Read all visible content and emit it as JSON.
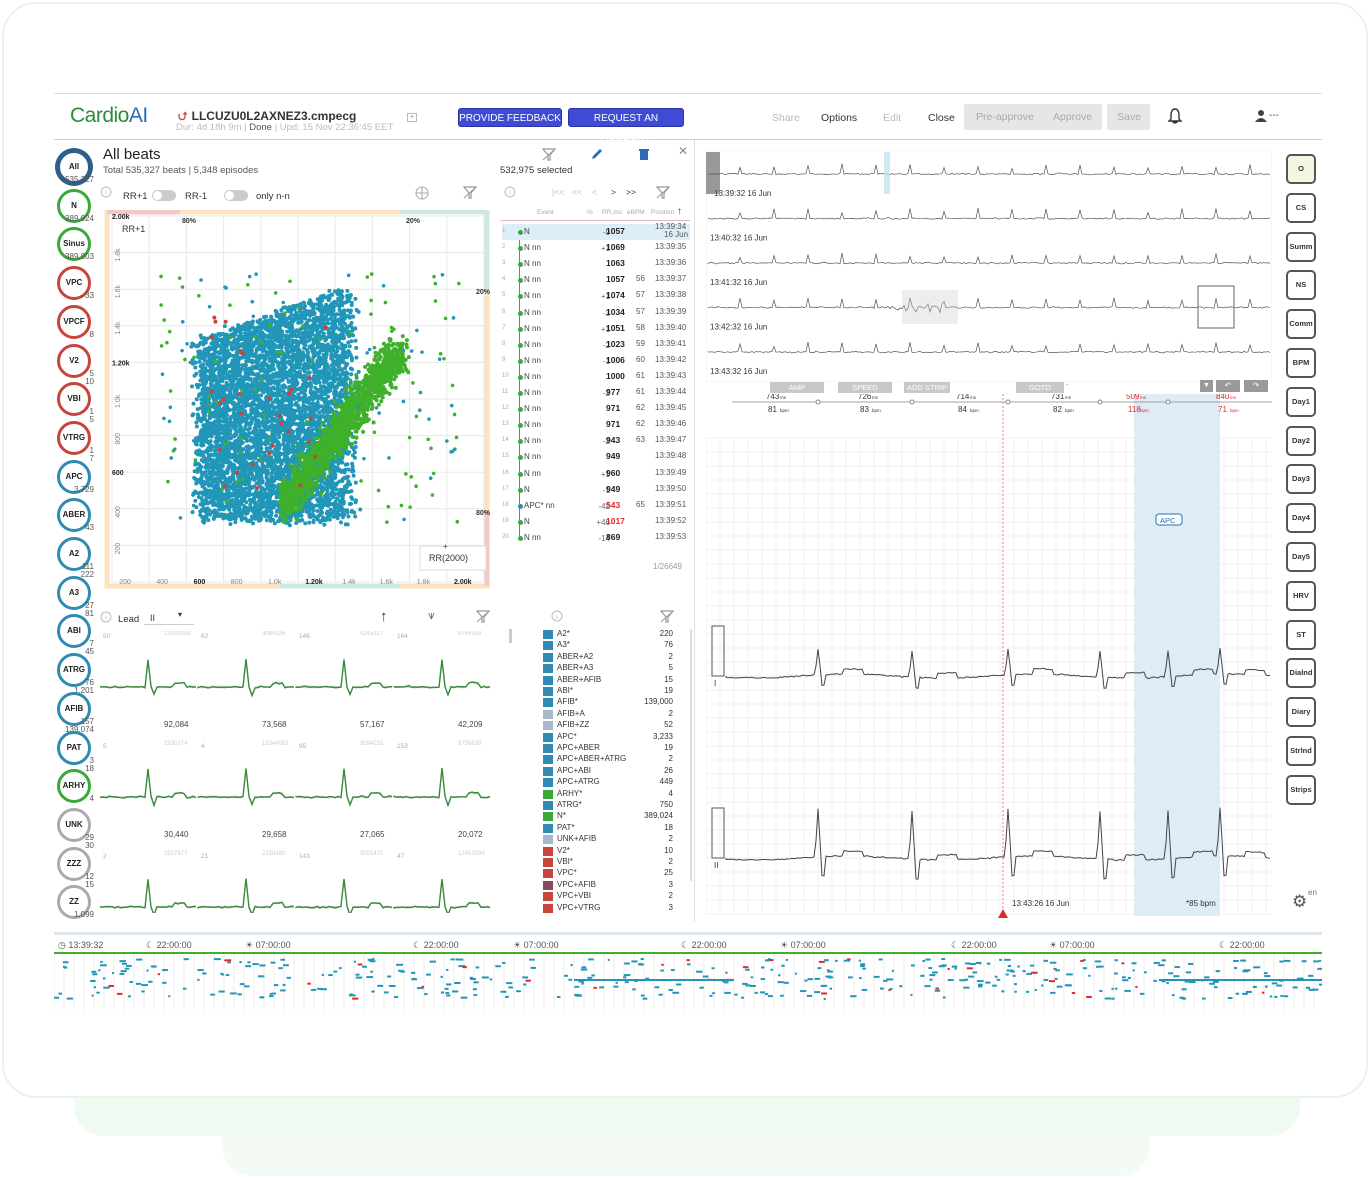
{
  "header": {
    "logo_main": "Cardio",
    "logo_ai": "AI",
    "file_name": "LLCUZU0L2AXNEZ3.cmpecg",
    "meta_dur": "Dur: 4d 18h 9m",
    "meta_status": "Done",
    "meta_upd": "Upd: 15 Nov 22:36:45 EET",
    "feedback_label": "PROVIDE FEEDBACK",
    "request_label": "REQUEST AN ACCOUNT",
    "share": "Share",
    "options": "Options",
    "edit": "Edit",
    "close": "Close",
    "preapprove": "Pre-approve",
    "approve": "Approve",
    "save": "Save",
    "user": "---"
  },
  "badges": [
    {
      "label": "All",
      "count": "535,327",
      "color": "#2d5f8a"
    },
    {
      "label": "N",
      "count": "389,024",
      "color": "#3aa83a"
    },
    {
      "label": "Sinus",
      "count": "389,803",
      "color": "#3aa83a"
    },
    {
      "label": "VPC",
      "count": "33",
      "color": "#c8453c"
    },
    {
      "label": "VPCF",
      "count": "8",
      "color": "#c8453c"
    },
    {
      "label": "V2",
      "count": "5",
      "count2": "10",
      "color": "#c8453c"
    },
    {
      "label": "VBI",
      "count": "1",
      "count2": "5",
      "color": "#c8453c"
    },
    {
      "label": "VTRG",
      "count": "1",
      "count2": "7",
      "color": "#c8453c"
    },
    {
      "label": "APC",
      "count": "3,729",
      "color": "#2f8bb3"
    },
    {
      "label": "ABER",
      "count": "43",
      "color": "#2f8bb3"
    },
    {
      "label": "A2",
      "count": "111",
      "count2": "222",
      "color": "#2f8bb3"
    },
    {
      "label": "A3",
      "count": "27",
      "count2": "81",
      "color": "#2f8bb3"
    },
    {
      "label": "ABI",
      "count": "7",
      "count2": "45",
      "color": "#2f8bb3"
    },
    {
      "label": "ATRG",
      "count": "76",
      "count2": "1,201",
      "color": "#2f8bb3"
    },
    {
      "label": "AFIB",
      "count": "157",
      "count2": "139,074",
      "color": "#2f8bb3"
    },
    {
      "label": "PAT",
      "count": "3",
      "count2": "18",
      "color": "#2f8bb3"
    },
    {
      "label": "ARHY",
      "count": "4",
      "color": "#3aa83a"
    },
    {
      "label": "UNK",
      "count": "29",
      "count2": "30",
      "color": "#aaaaaa"
    },
    {
      "label": "ZZZ",
      "count": "12",
      "count2": "15",
      "color": "#aaaaaa"
    },
    {
      "label": "ZZ",
      "count": "1,099",
      "color": "#aaaaaa"
    }
  ],
  "beats": {
    "title": "All beats",
    "total": "Total 535,327 beats | 5,348 episodes",
    "selected": "532,975 selected",
    "rr_plus": "RR+1",
    "rr_minus": "RR-1",
    "only_nn": "only n-n"
  },
  "scatter": {
    "axis_label": "RR+1",
    "y_ticks": [
      "2.00k",
      "1.8k",
      "1.6k",
      "1.4k",
      "1.20k",
      "1.0k",
      "800",
      "600",
      "400",
      "200"
    ],
    "x_ticks": [
      "200",
      "400",
      "600",
      "800",
      "1.0k",
      "1.20k",
      "1.4k",
      "1.6k",
      "1.8k",
      "2.00k"
    ],
    "pct_tl": "80%",
    "pct_tr": "20%",
    "pct_r": "20%",
    "pct_br": "80%",
    "rr_label": "RR(2000)",
    "plus": "+"
  },
  "events": {
    "nav_first": "|<<",
    "nav_prev2": "<<",
    "nav_prev": "<",
    "nav_next": ">",
    "nav_next2": ">>",
    "col_event": "Event",
    "col_pct": "-%",
    "col_rr": "RR,ms",
    "col_bpm": "eBPM",
    "col_pos": "Position",
    "rows": [
      {
        "idx": "1",
        "ev": "N",
        "diff": "-9",
        "rr": "1057",
        "bpm": "",
        "time": "13:39:34",
        "date": "16 Jun",
        "sel": true
      },
      {
        "idx": "2",
        "ev": "N nn",
        "diff": "+1",
        "rr": "1069",
        "bpm": "",
        "time": "13:39:35"
      },
      {
        "idx": "3",
        "ev": "N nn",
        "diff": "",
        "rr": "1063",
        "bpm": "",
        "time": "13:39:36"
      },
      {
        "idx": "4",
        "ev": "N nn",
        "diff": "",
        "rr": "1057",
        "bpm": "56",
        "time": "13:39:37"
      },
      {
        "idx": "5",
        "ev": "N nn",
        "diff": "+1",
        "rr": "1074",
        "bpm": "57",
        "time": "13:39:38"
      },
      {
        "idx": "6",
        "ev": "N nn",
        "diff": "-3",
        "rr": "1034",
        "bpm": "57",
        "time": "13:39:39"
      },
      {
        "idx": "7",
        "ev": "N nn",
        "diff": "+1",
        "rr": "1051",
        "bpm": "58",
        "time": "13:39:40"
      },
      {
        "idx": "8",
        "ev": "N nn",
        "diff": "-2",
        "rr": "1023",
        "bpm": "59",
        "time": "13:39:41"
      },
      {
        "idx": "9",
        "ev": "N nn",
        "diff": "-1",
        "rr": "1006",
        "bpm": "60",
        "time": "13:39:42"
      },
      {
        "idx": "10",
        "ev": "N nn",
        "diff": "",
        "rr": "1000",
        "bpm": "61",
        "time": "13:39:43"
      },
      {
        "idx": "11",
        "ev": "N nn",
        "diff": "-2",
        "rr": "977",
        "bpm": "61",
        "time": "13:39:44"
      },
      {
        "idx": "12",
        "ev": "N nn",
        "diff": "",
        "rr": "971",
        "bpm": "62",
        "time": "13:39:45"
      },
      {
        "idx": "13",
        "ev": "N nn",
        "diff": "",
        "rr": "971",
        "bpm": "62",
        "time": "13:39:46"
      },
      {
        "idx": "14",
        "ev": "N nn",
        "diff": "-2",
        "rr": "943",
        "bpm": "63",
        "time": "13:39:47"
      },
      {
        "idx": "15",
        "ev": "N nn",
        "diff": "",
        "rr": "949",
        "bpm": "",
        "time": "13:39:48"
      },
      {
        "idx": "16",
        "ev": "N nn",
        "diff": "+1",
        "rr": "960",
        "bpm": "",
        "time": "13:39:49"
      },
      {
        "idx": "17",
        "ev": "N",
        "diff": "-1",
        "rr": "949",
        "bpm": "",
        "time": "13:39:50"
      },
      {
        "idx": "18",
        "ev": "APC* nn",
        "diff": "-42",
        "rr": "543",
        "bpm": "65",
        "time": "13:39:51",
        "red": true,
        "blue": true
      },
      {
        "idx": "19",
        "ev": "N",
        "diff": "+46",
        "rr": "1017",
        "bpm": "",
        "time": "13:39:52",
        "red": true
      },
      {
        "idx": "20",
        "ev": "N nn",
        "diff": "-14",
        "rr": "869",
        "bpm": "",
        "time": "13:39:53"
      }
    ],
    "page": "1/26649"
  },
  "templates": {
    "lead_label": "Lead",
    "lead_value": "II",
    "cells": [
      {
        "num": "50",
        "id": "12033298",
        "count": "92,084"
      },
      {
        "num": "62",
        "id": "3094326",
        "count": "73,568"
      },
      {
        "num": "146",
        "id": "9245317",
        "count": "57,167"
      },
      {
        "num": "164",
        "id": "9765509",
        "count": "42,209"
      },
      {
        "num": "5",
        "id": "2330374",
        "count": "30,440"
      },
      {
        "num": "4",
        "id": "15344061",
        "count": "29,658"
      },
      {
        "num": "95",
        "id": "3094255",
        "count": "27,065"
      },
      {
        "num": "153",
        "id": "9756639",
        "count": "20,072"
      },
      {
        "num": "2",
        "id": "2527677",
        "count": ""
      },
      {
        "num": "21",
        "id": "2150480",
        "count": ""
      },
      {
        "num": "143",
        "id": "3025471",
        "count": ""
      },
      {
        "num": "47",
        "id": "12451596",
        "count": ""
      }
    ]
  },
  "legend": [
    {
      "name": "A2*",
      "value": "220",
      "color": "#2f8bb3"
    },
    {
      "name": "A3*",
      "value": "76",
      "color": "#2f8bb3"
    },
    {
      "name": "ABER+A2",
      "value": "2",
      "color": "#2f8bb3"
    },
    {
      "name": "ABER+A3",
      "value": "5",
      "color": "#2f8bb3"
    },
    {
      "name": "ABER+AFIB",
      "value": "15",
      "color": "#2f8bb3"
    },
    {
      "name": "ABI*",
      "value": "19",
      "color": "#2f8bb3"
    },
    {
      "name": "AFIB*",
      "value": "139,000",
      "color": "#2f8bb3"
    },
    {
      "name": "AFIB+A",
      "value": "2",
      "color": "#a8b8c8"
    },
    {
      "name": "AFIB+ZZ",
      "value": "52",
      "color": "#a8b8c8"
    },
    {
      "name": "APC*",
      "value": "3,233",
      "color": "#2f8bb3"
    },
    {
      "name": "APC+ABER",
      "value": "19",
      "color": "#2f8bb3"
    },
    {
      "name": "APC+ABER+ATRG",
      "value": "2",
      "color": "#2f8bb3"
    },
    {
      "name": "APC+ABI",
      "value": "26",
      "color": "#2f8bb3"
    },
    {
      "name": "APC+ATRG",
      "value": "449",
      "color": "#2f8bb3"
    },
    {
      "name": "ARHY*",
      "value": "4",
      "color": "#3aa83a"
    },
    {
      "name": "ATRG*",
      "value": "750",
      "color": "#2f8bb3"
    },
    {
      "name": "N*",
      "value": "389,024",
      "color": "#3aa83a"
    },
    {
      "name": "PAT*",
      "value": "18",
      "color": "#2f8bb3"
    },
    {
      "name": "UNK+AFIB",
      "value": "2",
      "color": "#a8b8c8"
    },
    {
      "name": "V2*",
      "value": "10",
      "color": "#c8453c"
    },
    {
      "name": "VBI*",
      "value": "2",
      "color": "#c8453c"
    },
    {
      "name": "VPC*",
      "value": "25",
      "color": "#c8453c"
    },
    {
      "name": "VPC+AFIB",
      "value": "3",
      "color": "#8a4a5a"
    },
    {
      "name": "VPC+VBI",
      "value": "2",
      "color": "#c8453c"
    },
    {
      "name": "VPC+VTRG",
      "value": "3",
      "color": "#c8453c"
    }
  ],
  "strips": {
    "times": [
      "13:39:32 16 Jun",
      "13:40:32 16 Jun",
      "13:41:32 16 Jun",
      "13:42:32 16 Jun",
      "13:43:32 16 Jun"
    ]
  },
  "ecg": {
    "tabs": [
      "AMP",
      "SPEED",
      "ADD STRIP",
      "GOTO"
    ],
    "goto_value": "-",
    "intervals": [
      {
        "ms": "743",
        "bpm": "81"
      },
      {
        "ms": "726",
        "bpm": "83"
      },
      {
        "ms": "714",
        "bpm": "84"
      },
      {
        "ms": "731",
        "bpm": "82"
      },
      {
        "ms": "509",
        "bpm": "118",
        "red": true
      },
      {
        "ms": "840",
        "bpm": "71",
        "red": true
      }
    ],
    "ms_unit": "ms",
    "bpm_unit": "bpm",
    "apc_label": "APC",
    "lead1": "I",
    "lead2": "II",
    "time_label": "13:43:26 16 Jun",
    "bpm_label": "*85 bpm"
  },
  "side_buttons": [
    "O",
    "CS",
    "Summ",
    "NS",
    "Comm",
    "BPM",
    "Day1",
    "Day2",
    "Day3",
    "Day4",
    "Day5",
    "HRV",
    "ST",
    "Dialnd",
    "Diary",
    "Strlnd",
    "Strips"
  ],
  "lang": "en",
  "timeline": {
    "labels": [
      "13:39:32",
      "22:00:00",
      "07:00:00",
      "22:00:00",
      "07:00:00",
      "22:00:00",
      "07:00:00",
      "22:00:00",
      "07:00:00",
      "22:00:00"
    ]
  }
}
